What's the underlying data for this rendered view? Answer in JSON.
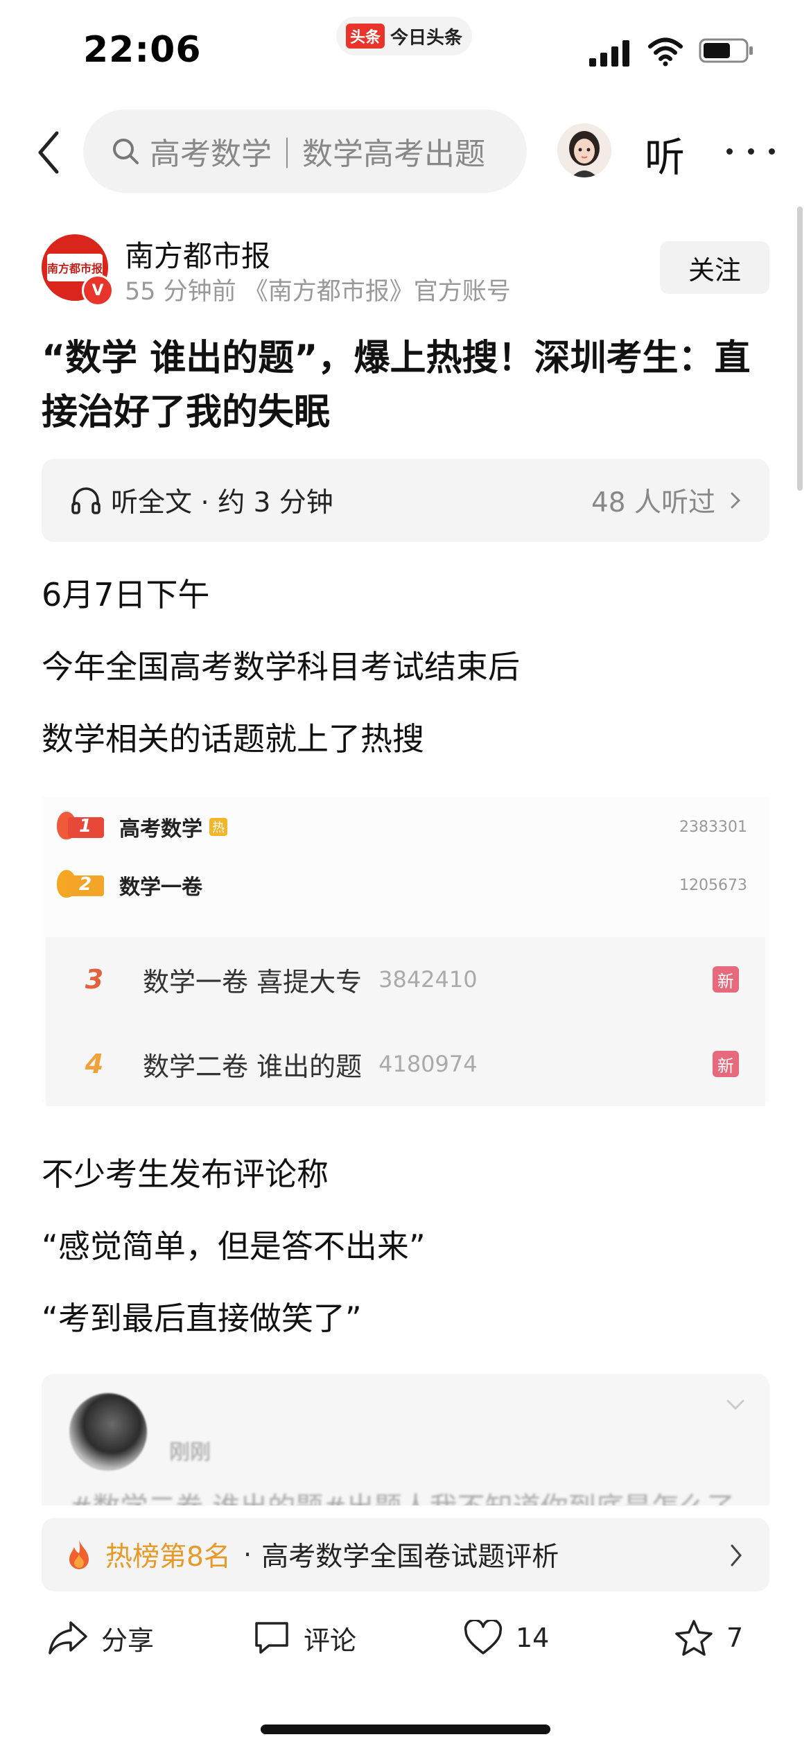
{
  "status_bar": {
    "time": "22:06",
    "app_logo": "头条",
    "app_name": "今日头条"
  },
  "nav": {
    "search_query": "高考数学｜数学高考出题",
    "listen_label": "听"
  },
  "author": {
    "name": "南方都市报",
    "logo_text": "南方都市报",
    "badge": "V",
    "meta": "55 分钟前  《南方都市报》官方账号",
    "follow_label": "关注"
  },
  "article": {
    "title": "“数学 谁出的题”，爆上热搜！深圳考生：直接治好了我的失眠",
    "listen": {
      "label": "听全文 · 约 3 分钟",
      "listeners": "48 人听过"
    },
    "paragraphs": [
      "6月7日下午",
      "今年全国高考数学科目考试结束后",
      "数学相关的话题就上了热搜"
    ],
    "paragraphs2": [
      "不少考生发布评论称",
      "“感觉简单，但是答不出来”",
      "“考到最后直接做笑了”"
    ]
  },
  "hot_search": {
    "top": [
      {
        "rank": "1",
        "title": "高考数学",
        "tag": "热",
        "count": "2383301"
      },
      {
        "rank": "2",
        "title": "数学一卷",
        "count": "1205673"
      }
    ],
    "list": [
      {
        "rank": "3",
        "title": "数学一卷 喜提大专",
        "count": "3842410",
        "tag": "新"
      },
      {
        "rank": "4",
        "title": "数学二卷 谁出的题",
        "count": "4180974",
        "tag": "新"
      }
    ]
  },
  "comment_card": {
    "user": "刚刚",
    "text": "#数学二卷 谁出的题#出题人我不知道你到底是怎么了"
  },
  "hot_rank_bar": {
    "rank": "热榜第8名",
    "separator": "·",
    "topic": "高考数学全国卷试题评析"
  },
  "toolbar": {
    "share": "分享",
    "comment": "评论",
    "like_count": "14",
    "favorite_count": "7"
  },
  "colors": {
    "accent_red": "#e8342b",
    "hot_orange": "#e69a27",
    "new_tag": "#e66a7c"
  }
}
